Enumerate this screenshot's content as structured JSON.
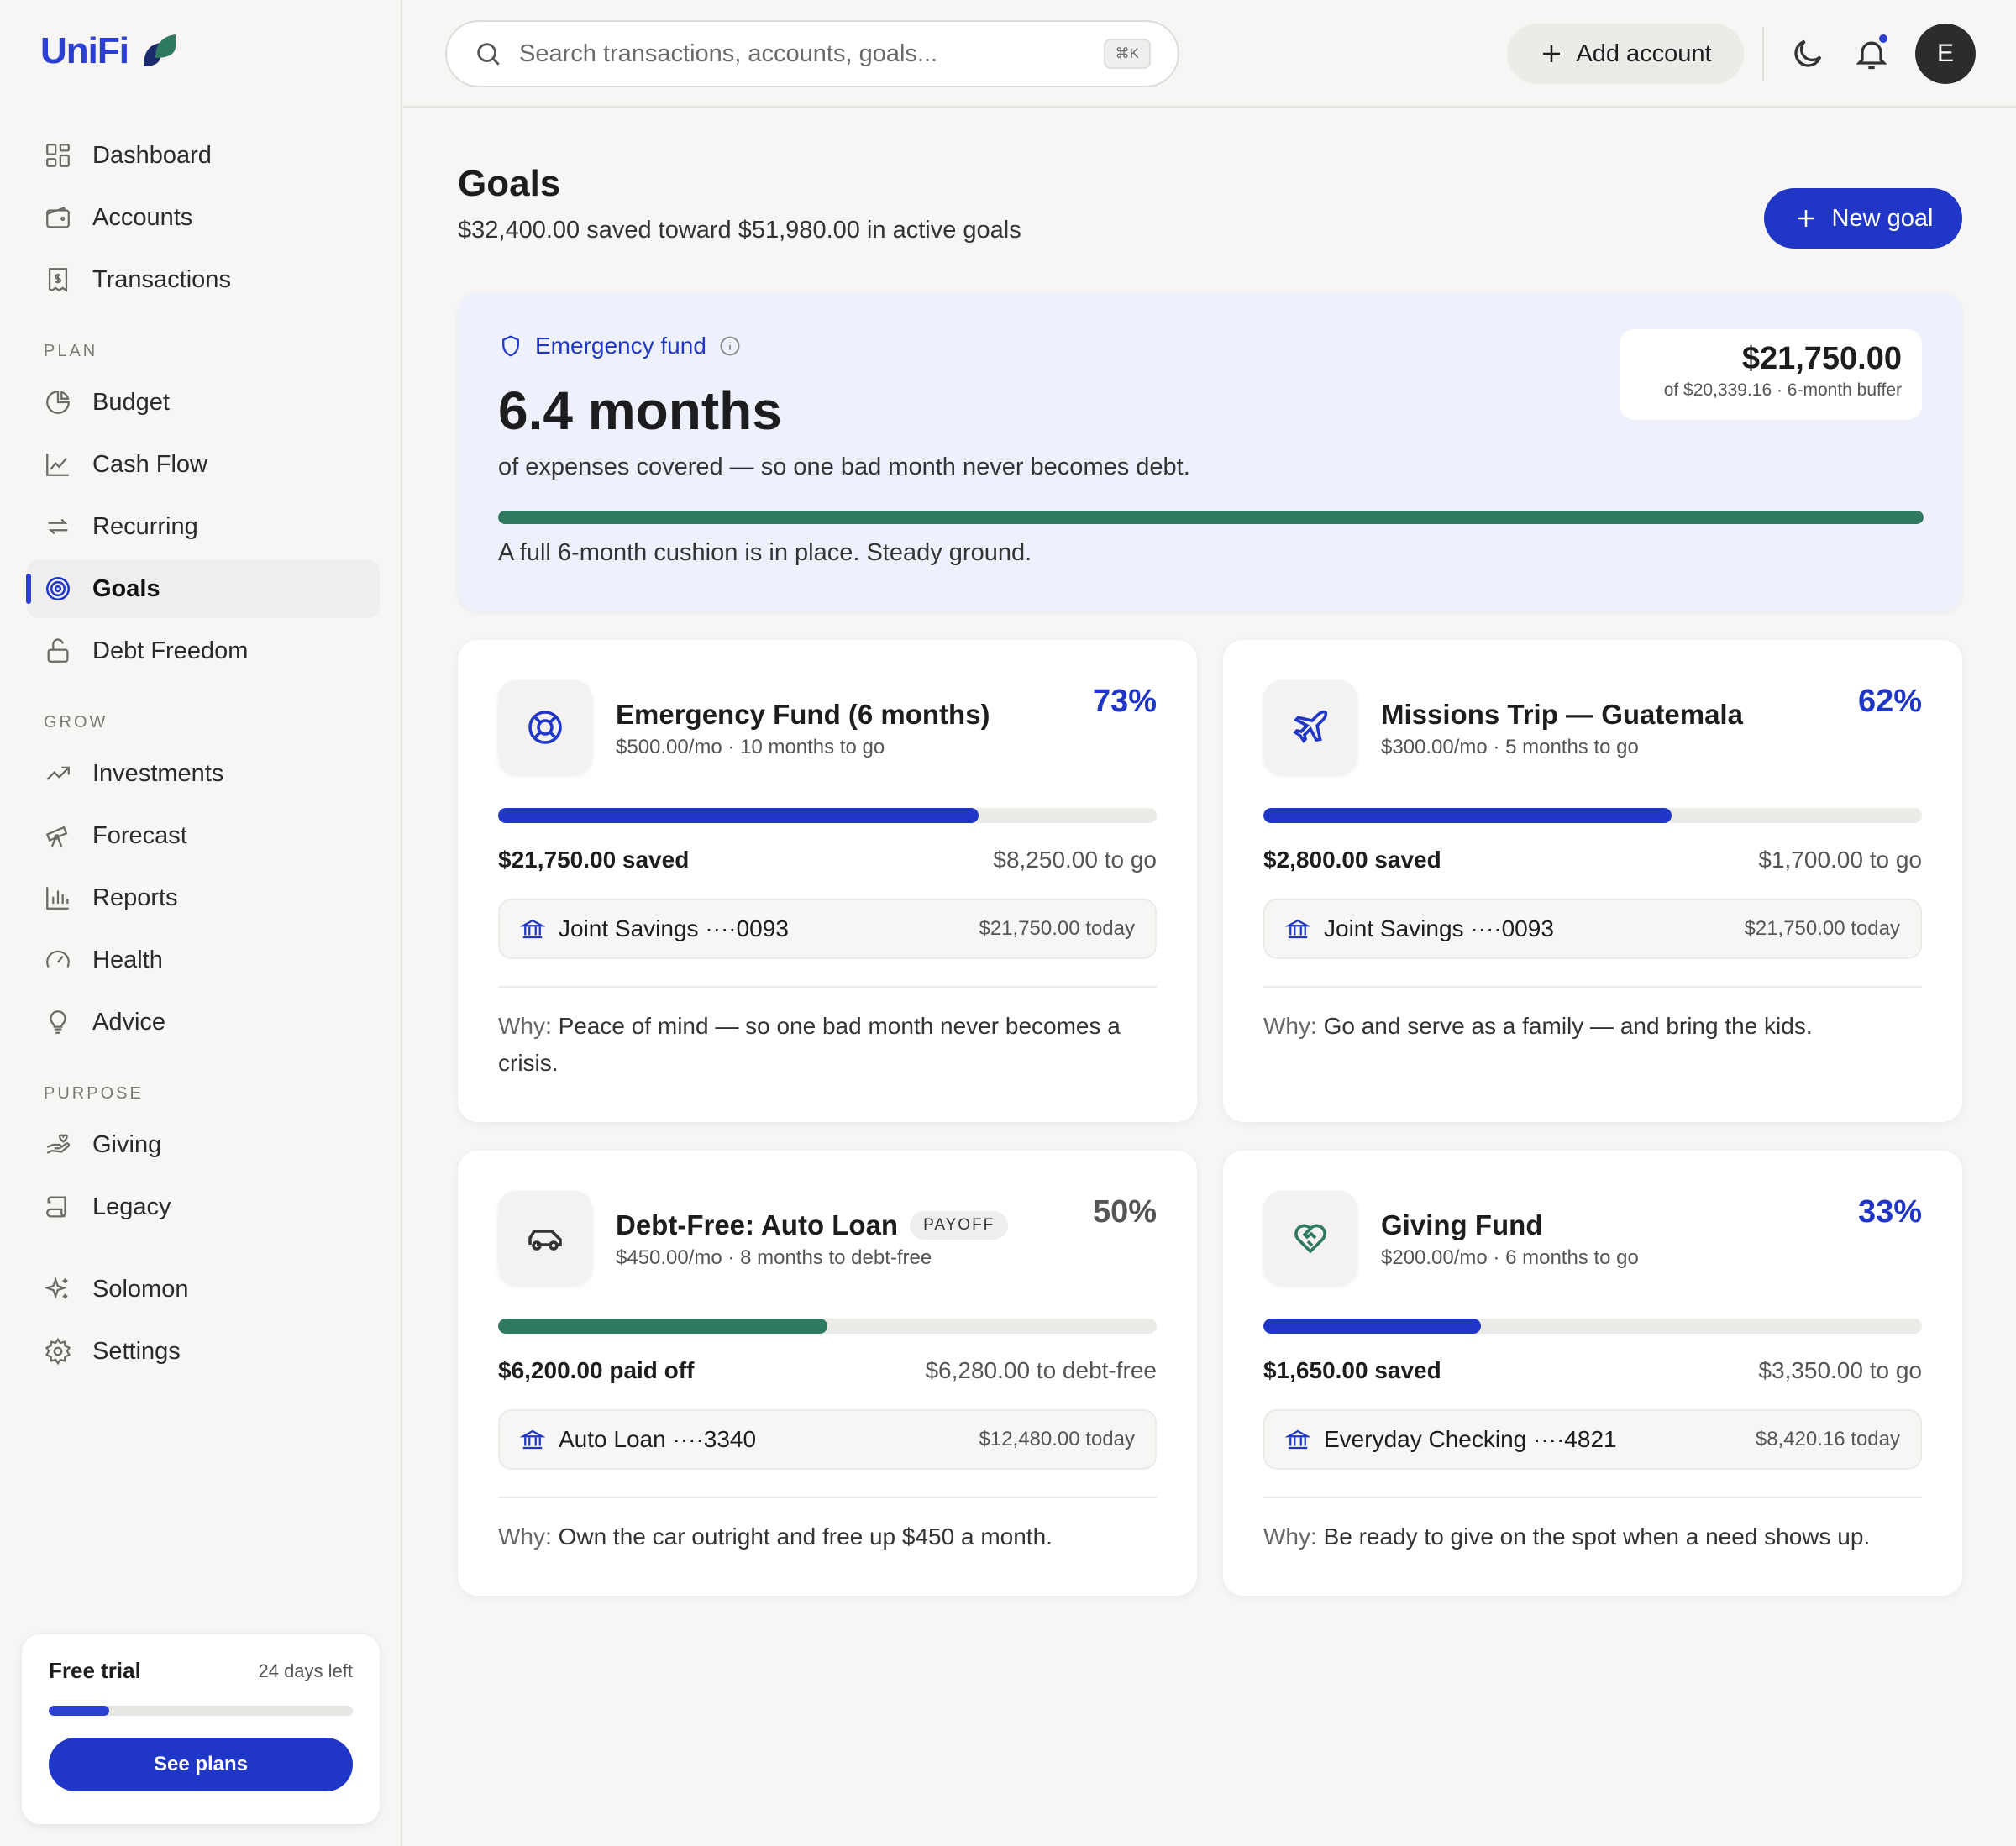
{
  "brand": {
    "name_a": "Uni",
    "name_b": "Fi"
  },
  "nav": {
    "main": [
      {
        "label": "Dashboard",
        "icon": "grid-icon"
      },
      {
        "label": "Accounts",
        "icon": "wallet-icon"
      },
      {
        "label": "Transactions",
        "icon": "receipt-icon"
      }
    ],
    "plan_title": "PLAN",
    "plan": [
      {
        "label": "Budget",
        "icon": "pie-chart-icon"
      },
      {
        "label": "Cash Flow",
        "icon": "line-chart-icon"
      },
      {
        "label": "Recurring",
        "icon": "repeat-icon"
      },
      {
        "label": "Goals",
        "icon": "target-icon",
        "active": true
      },
      {
        "label": "Debt Freedom",
        "icon": "unlock-icon"
      }
    ],
    "grow_title": "GROW",
    "grow": [
      {
        "label": "Investments",
        "icon": "trending-up-icon"
      },
      {
        "label": "Forecast",
        "icon": "telescope-icon"
      },
      {
        "label": "Reports",
        "icon": "bar-chart-icon"
      },
      {
        "label": "Health",
        "icon": "gauge-icon"
      },
      {
        "label": "Advice",
        "icon": "lightbulb-icon"
      }
    ],
    "purpose_title": "PURPOSE",
    "purpose": [
      {
        "label": "Giving",
        "icon": "hand-heart-icon"
      },
      {
        "label": "Legacy",
        "icon": "scroll-icon"
      }
    ],
    "bottom": [
      {
        "label": "Solomon",
        "icon": "sparkles-icon"
      },
      {
        "label": "Settings",
        "icon": "gear-icon"
      }
    ]
  },
  "trial": {
    "title": "Free trial",
    "days": "24 days left",
    "progress": 0.2,
    "button": "See plans"
  },
  "topbar": {
    "search_placeholder": "Search transactions, accounts, goals...",
    "shortcut": "⌘K",
    "add_account": "Add account",
    "avatar_initial": "E"
  },
  "page": {
    "title": "Goals",
    "subtitle": "$32,400.00 saved toward $51,980.00 in active goals",
    "new_goal": "New goal"
  },
  "emergency": {
    "label": "Emergency fund",
    "big": "6.4 months",
    "desc": "of expenses covered — so one bad month never becomes debt.",
    "progress": 1.0,
    "note": "A full 6-month cushion is in place. Steady ground.",
    "amount": "$21,750.00",
    "amount_sub": "of $20,339.16 · 6-month buffer",
    "accent": "#2f7a5f"
  },
  "goals": [
    {
      "title": "Emergency Fund (6 months)",
      "badge": "",
      "sub": "$500.00/mo · 10 months to go",
      "pct": "73%",
      "progress": 0.73,
      "saved": "$21,750.00 saved",
      "togo": "$8,250.00 to go",
      "account": "Joint Savings ····0093",
      "balance": "$21,750.00 today",
      "why_label": "Why:",
      "why": "Peace of mind — so one bad month never becomes a crisis.",
      "icon": "lifebuoy-icon"
    },
    {
      "title": "Missions Trip — Guatemala",
      "badge": "",
      "sub": "$300.00/mo · 5 months to go",
      "pct": "62%",
      "progress": 0.62,
      "saved": "$2,800.00 saved",
      "togo": "$1,700.00 to go",
      "account": "Joint Savings ····0093",
      "balance": "$21,750.00 today",
      "why_label": "Why:",
      "why": "Go and serve as a family — and bring the kids.",
      "icon": "plane-icon"
    },
    {
      "title": "Debt-Free: Auto Loan",
      "badge": "PAYOFF",
      "sub": "$450.00/mo · 8 months to debt-free",
      "pct": "50%",
      "progress": 0.5,
      "saved": "$6,200.00 paid off",
      "togo": "$6,280.00 to debt-free",
      "account": "Auto Loan ····3340",
      "balance": "$12,480.00 today",
      "why_label": "Why:",
      "why": "Own the car outright and free up $450 a month.",
      "icon": "car-icon"
    },
    {
      "title": "Giving Fund",
      "badge": "",
      "sub": "$200.00/mo · 6 months to go",
      "pct": "33%",
      "progress": 0.33,
      "saved": "$1,650.00 saved",
      "togo": "$3,350.00 to go",
      "account": "Everyday Checking ····4821",
      "balance": "$8,420.16 today",
      "why_label": "Why:",
      "why": "Be ready to give on the spot when a need shows up.",
      "icon": "heart-handshake-icon"
    }
  ]
}
